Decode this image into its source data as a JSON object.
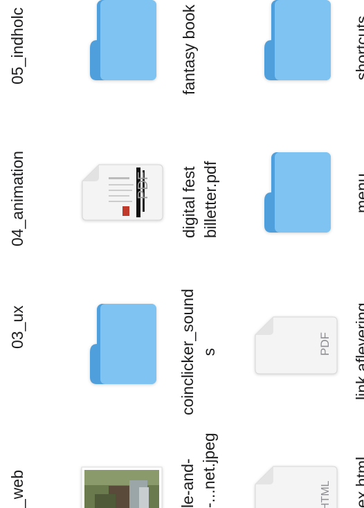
{
  "icons": {
    "folder": "folder-icon",
    "pdf": "pdf-document-icon",
    "html": "html-document-icon",
    "image": "image-thumbnail-icon"
  },
  "colors": {
    "folder_body": "#7ec3f1",
    "folder_tab": "#4f9fdc",
    "text": "#1d1d1f",
    "doc_paper": "#f4f4f4",
    "doc_label": "#8e8e93"
  },
  "files": {
    "f05": {
      "name": "05_indholc"
    },
    "f04": {
      "name": "04_animation"
    },
    "f03": {
      "name": "03_ux"
    },
    "f02": {
      "name": "_web"
    },
    "fantasy": {
      "line1": "fantasy book"
    },
    "digital": {
      "line1": "digital fest",
      "line2": "billetter.pdf"
    },
    "coin": {
      "line1": "coinclicker_sound",
      "line2": "s"
    },
    "jpeg": {
      "line1": "le-and-",
      "line2": "-...net.jpeg"
    },
    "shortcuts": {
      "line1": "shortcuts"
    },
    "menu": {
      "line1": "menu"
    },
    "link": {
      "line1": "link aflevering"
    },
    "html": {
      "line1": "ex.html"
    }
  },
  "doc_labels": {
    "pdf": "PDF",
    "html": "HTML"
  }
}
